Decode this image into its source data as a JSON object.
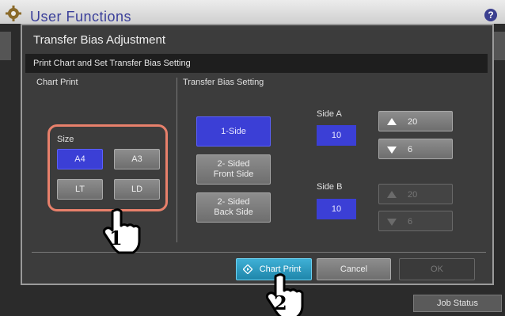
{
  "header": {
    "title": "User Functions",
    "help_label": "?"
  },
  "dialog": {
    "title": "Transfer Bias Adjustment",
    "subtitle": "Print Chart and Set Transfer Bias Setting",
    "chart_print": {
      "section_label": "Chart Print",
      "size_label": "Size",
      "sizes": [
        "A4",
        "A3",
        "LT",
        "LD"
      ],
      "selected": "A4"
    },
    "transfer_bias": {
      "section_label": "Transfer Bias Setting",
      "modes": [
        "1-Side",
        "2- Sided\nFront Side",
        "2- Sided\nBack Side"
      ],
      "selected": "1-Side",
      "side_a": {
        "label": "Side A",
        "value": "10",
        "up_value": "20",
        "down_value": "6"
      },
      "side_b": {
        "label": "Side B",
        "value": "10",
        "up_value": "20",
        "down_value": "6"
      }
    },
    "footer": {
      "chart_print_label": "Chart Print",
      "cancel_label": "Cancel",
      "ok_label": "OK"
    }
  },
  "job_status_label": "Job Status",
  "callouts": [
    "1",
    "2"
  ]
}
